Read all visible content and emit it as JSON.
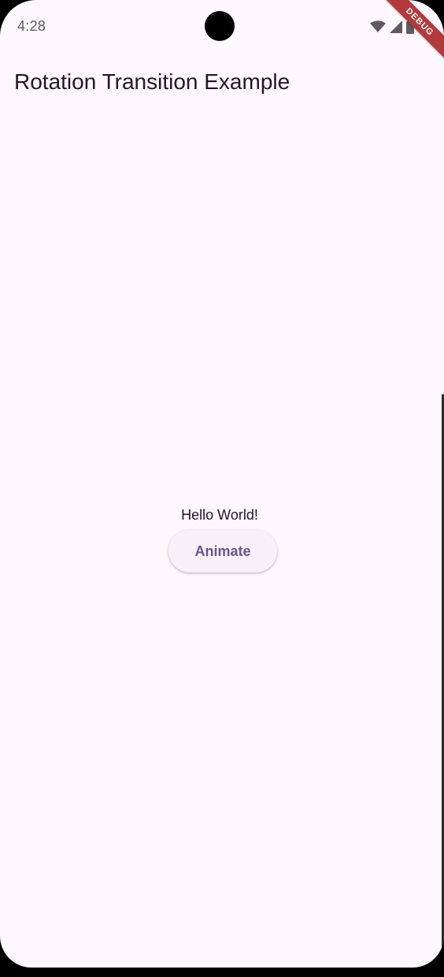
{
  "status_bar": {
    "time": "4:28",
    "icons": [
      "wifi-icon",
      "cell-signal-icon",
      "battery-icon"
    ]
  },
  "debug_banner": {
    "label": "DEBUG"
  },
  "app_bar": {
    "title": "Rotation Transition Example"
  },
  "body": {
    "hello_text": "Hello World!",
    "animate_label": "Animate"
  },
  "colors": {
    "background": "#fdf7fe",
    "title_text": "#1d1b20",
    "button_background": "#f7f2fa",
    "button_text": "#65558f",
    "debug_banner": "#b23a3a"
  }
}
